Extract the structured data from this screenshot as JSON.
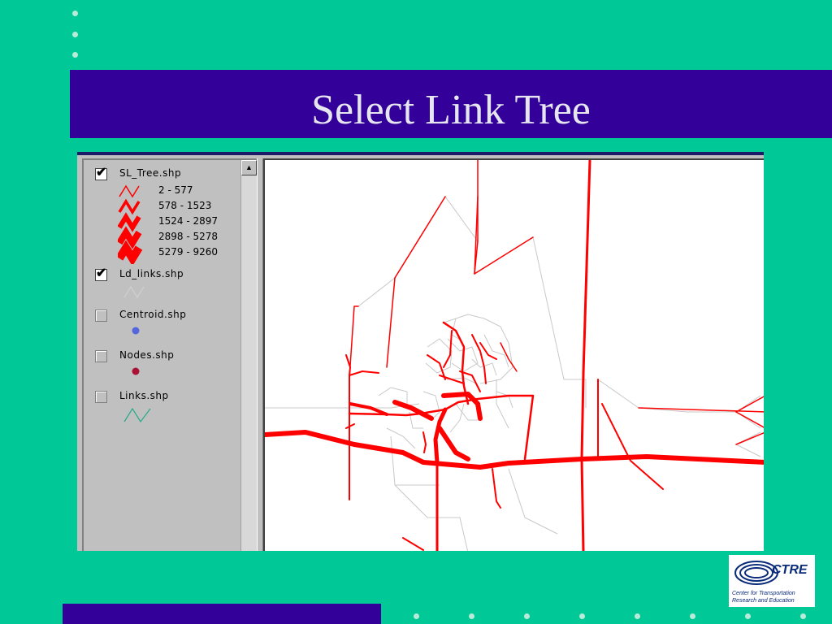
{
  "slide": {
    "title": "Select Link Tree",
    "colors": {
      "background": "#00c896",
      "title_bar": "#330099",
      "title_text": "#e6e6f0"
    }
  },
  "legend": {
    "layers": [
      {
        "name": "SL_Tree.shp",
        "checked": true,
        "symbol": "line-icon-red"
      },
      {
        "name": "Ld_links.shp",
        "checked": true,
        "symbol": "line-icon-lightgray"
      },
      {
        "name": "Centroid.shp",
        "checked": false,
        "symbol": "dot-icon-blue"
      },
      {
        "name": "Nodes.shp",
        "checked": false,
        "symbol": "dot-icon-darkred"
      },
      {
        "name": "Links.shp",
        "checked": false,
        "symbol": "line-icon-green"
      }
    ],
    "sl_tree_classes": [
      "2 - 577",
      "578 - 1523",
      "1524 - 2897",
      "2898 - 5278",
      "5279 - 9260"
    ],
    "colors": {
      "sl_tree": "#ff0000",
      "ld_links": "#cccccc",
      "centroid": "#5566dd",
      "nodes": "#aa1133",
      "links": "#22aa88"
    }
  },
  "map": {
    "colors": {
      "tree": "#ff0000",
      "network": "#c8c8c8",
      "background": "#ffffff"
    }
  },
  "logo": {
    "name": "CTRE",
    "line1": "Center for Transportation",
    "line2": "Research and Education"
  }
}
